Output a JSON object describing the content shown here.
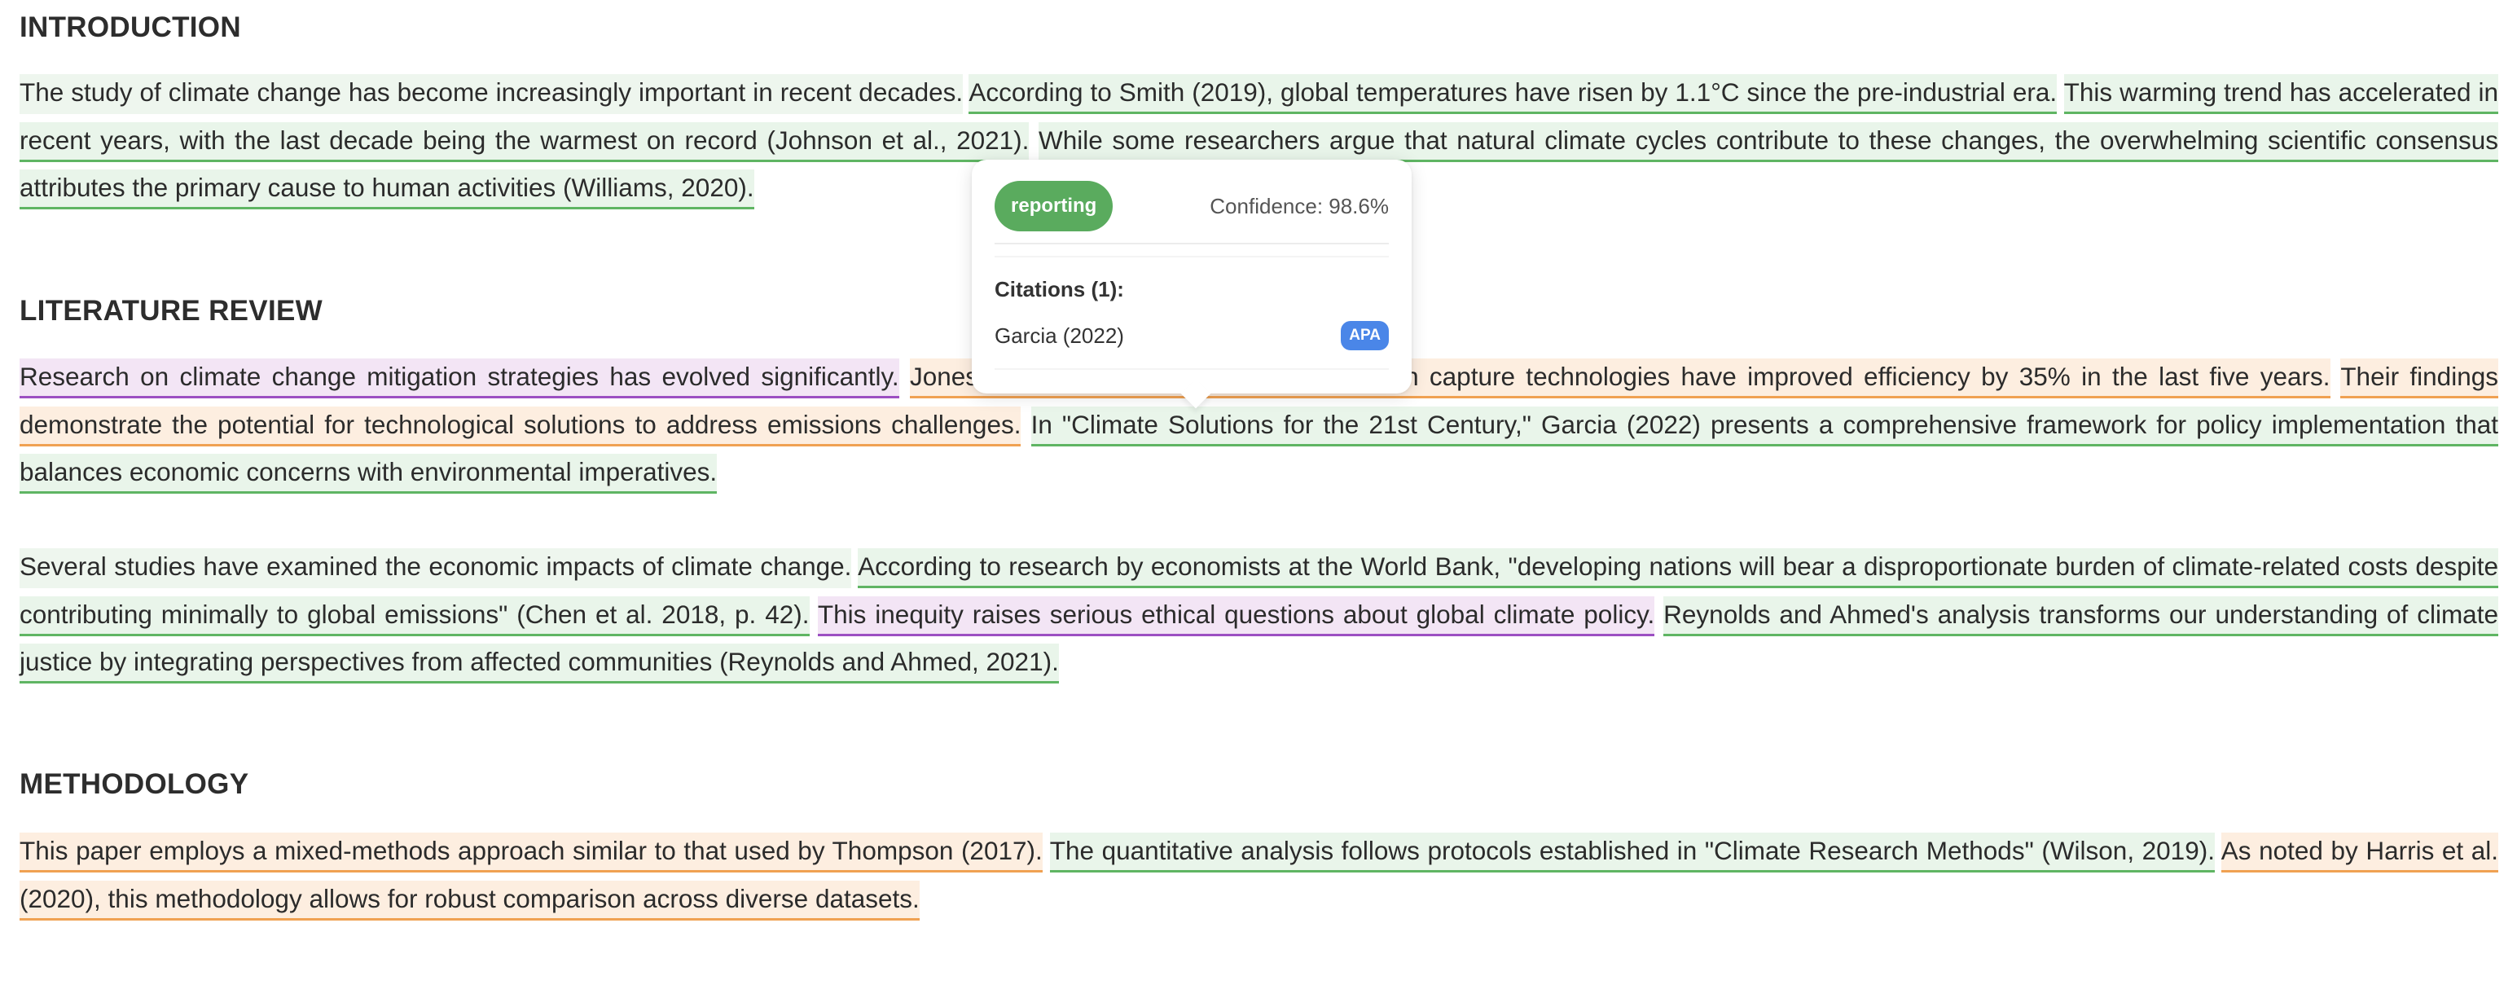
{
  "sections": {
    "introduction": {
      "heading": "INTRODUCTION",
      "s1": "The study of climate change has become increasingly important in recent decades.",
      "s2": "According to Smith (2019), global temperatures have risen by 1.1°C since the pre-industrial era.",
      "s3": "This warming trend has accelerated in recent years, with the last decade being the warmest on record (Johnson et al., 2021).",
      "s4": "While some researchers argue that natural climate cycles contribute to these changes, the overwhelming scientific consensus attributes the primary cause to human activities (Williams, 2020)."
    },
    "literature_review": {
      "heading": "LITERATURE REVIEW",
      "p1": {
        "s1": "Research on climate change mitigation strategies has evolved significantly.",
        "s2": "Jones and Brown (2018) found that carbon capture technologies have improved efficiency by 35% in the last five years.",
        "s3": "Their findings demonstrate the potential for technological solutions to address emissions challenges.",
        "s4": "In \"Climate Solutions for the 21st Century,\" Garcia (2022) presents a comprehensive framework for policy implementation that balances economic concerns with environmental imperatives."
      },
      "p2": {
        "s1": "Several studies have examined the economic impacts of climate change.",
        "s2": "According to research by economists at the World Bank, \"developing nations will bear a disproportionate burden of climate-related costs despite contributing minimally to global emissions\" (Chen et al. 2018, p. 42).",
        "s3": "This inequity raises serious ethical questions about global climate policy.",
        "s4": "Reynolds and Ahmed's analysis transforms our understanding of climate justice by integrating perspectives from affected communities (Reynolds and Ahmed, 2021)."
      }
    },
    "methodology": {
      "heading": "METHODOLOGY",
      "s1": "This paper employs a mixed-methods approach similar to that used by Thompson (2017).",
      "s2": "The quantitative analysis follows protocols established in \"Climate Research Methods\" (Wilson, 2019).",
      "s3": "As noted by Harris et al. (2020), this methodology allows for robust comparison across diverse datasets."
    }
  },
  "popover": {
    "type_label": "reporting",
    "confidence": "Confidence: 98.6%",
    "citations_heading": "Citations (1):",
    "citation_name": "Garcia (2022)",
    "citation_style": "APA"
  },
  "colors": {
    "reporting_bg": "#e9f5ea",
    "reporting_underline": "#5fb563",
    "claim_bg": "#f3e5f5",
    "claim_underline": "#9c4fc2",
    "summary_bg": "#fdeee0",
    "summary_underline": "#f0a152",
    "pill": "#5aab5e",
    "badge": "#4a86e8"
  }
}
